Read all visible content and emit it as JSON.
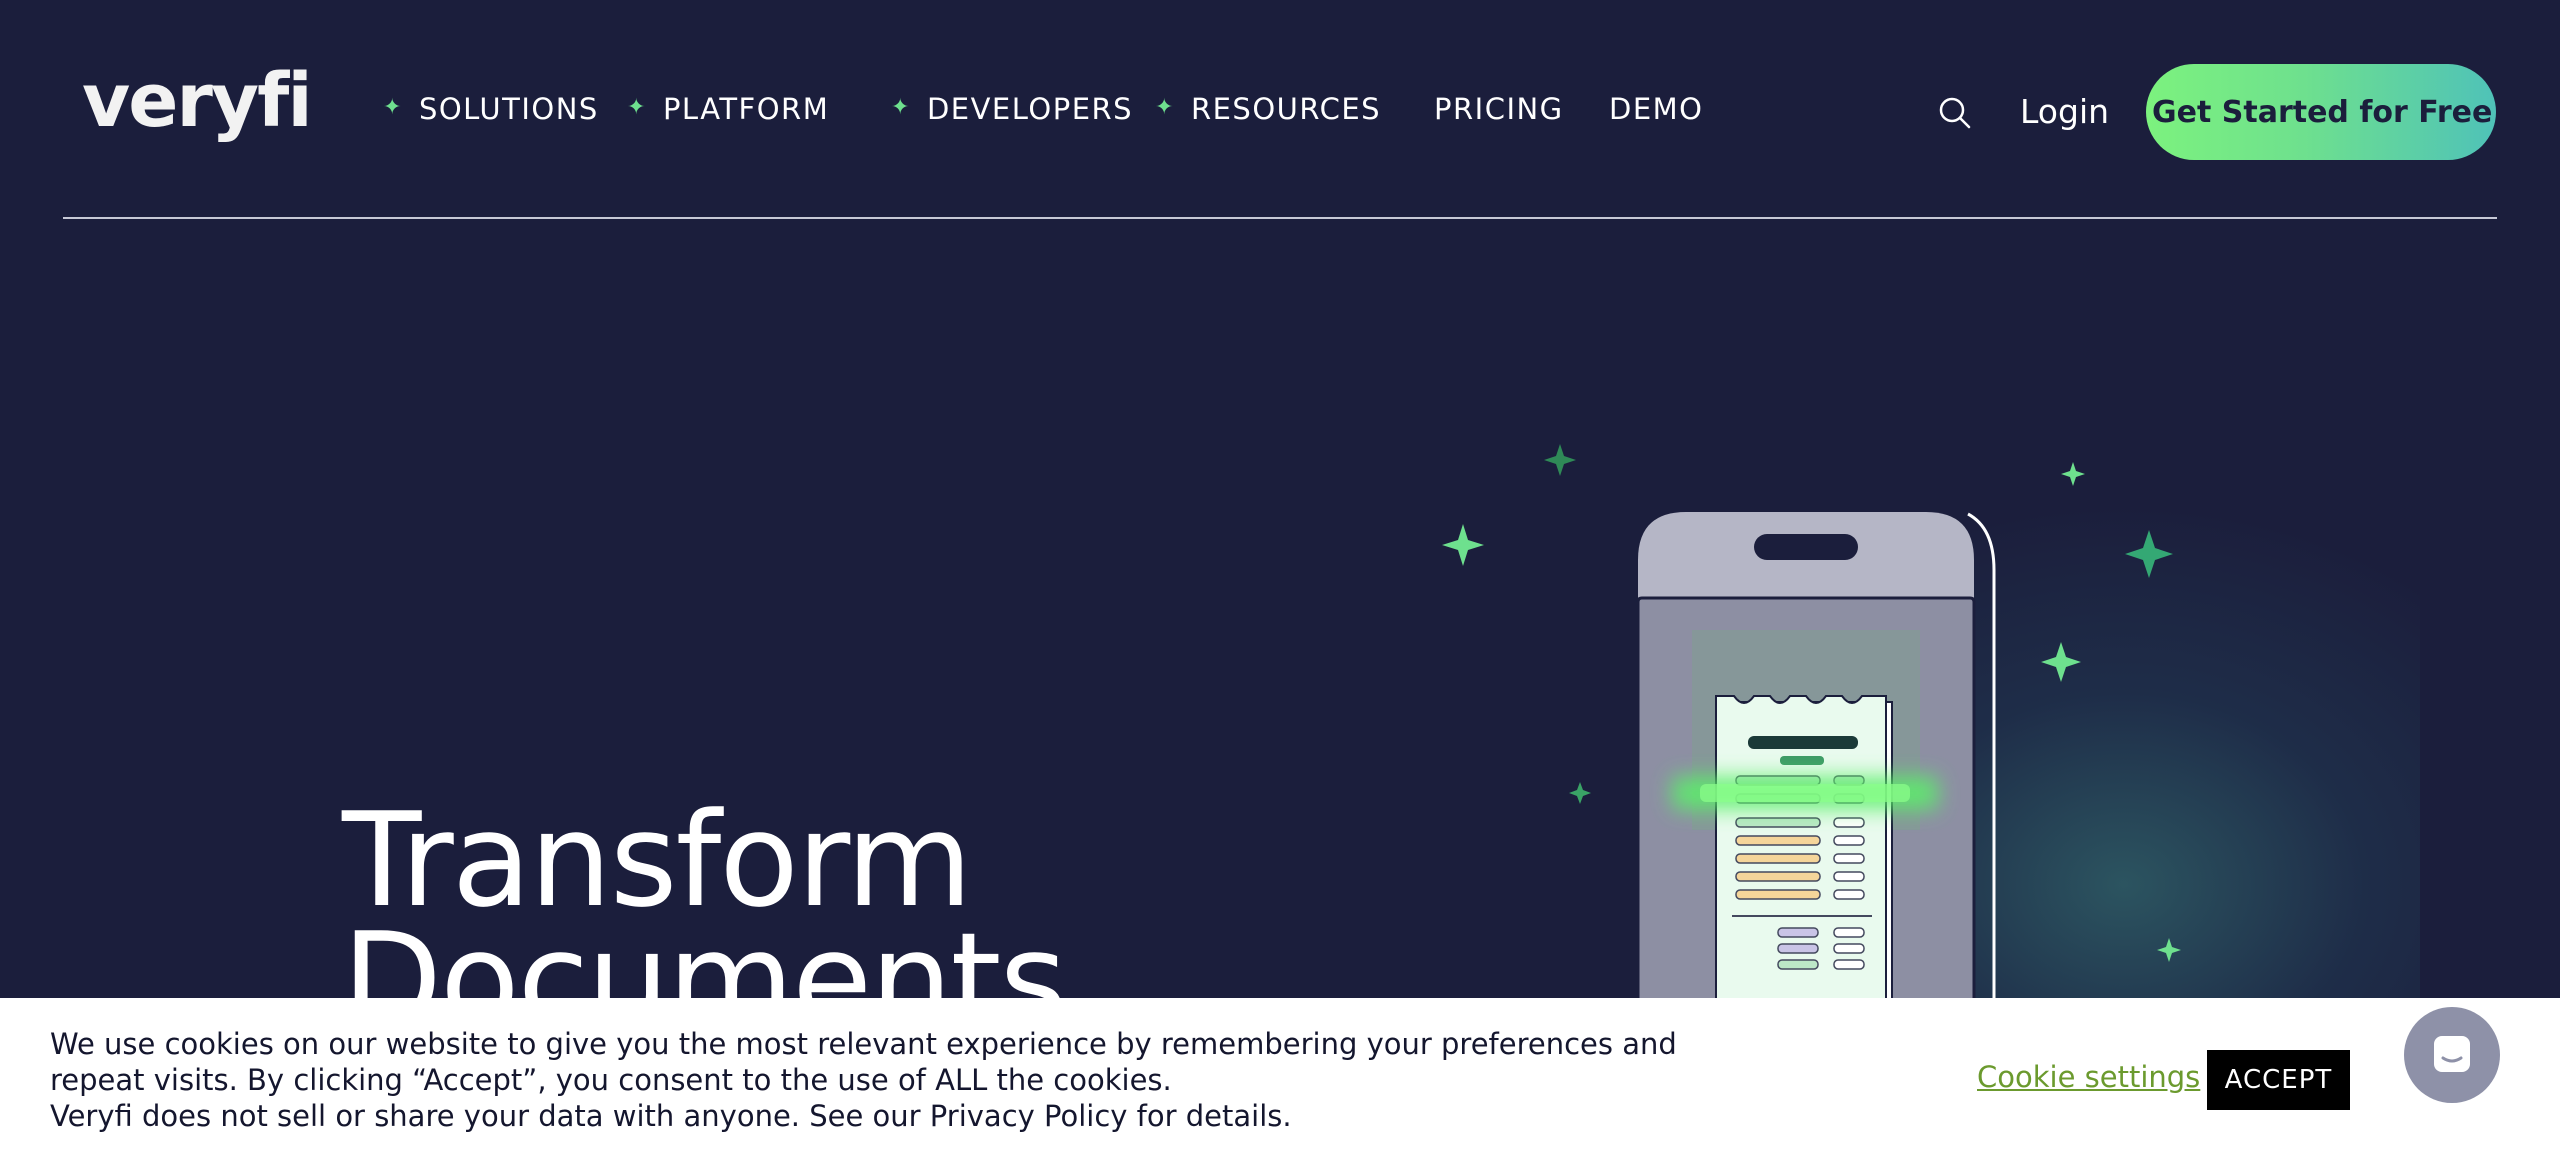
{
  "header": {
    "logo_text": "veryfi",
    "nav": [
      {
        "label": "SOLUTIONS",
        "has_spark": true
      },
      {
        "label": "PLATFORM",
        "has_spark": true
      },
      {
        "label": "DEVELOPERS",
        "has_spark": true
      },
      {
        "label": "RESOURCES",
        "has_spark": true
      },
      {
        "label": "PRICING",
        "has_spark": false
      },
      {
        "label": "DEMO",
        "has_spark": false
      }
    ],
    "spark_glyph": "✦",
    "search_icon": "search-icon",
    "login_label": "Login",
    "cta_label": "Get Started for Free"
  },
  "hero": {
    "title_line1": "Transform",
    "title_line2": "Documents"
  },
  "cookie_banner": {
    "text_line1": "We use cookies on our website to give you the most relevant experience by remembering your preferences and repeat visits. By clicking “Accept”, you consent to the use of ALL the cookies.",
    "text_line2": "Veryfi does not sell or share your data with anyone. See our Privacy Policy for details.",
    "settings_label": "Cookie settings",
    "accept_label": "ACCEPT"
  },
  "chat": {
    "icon": "chat-bubble-icon"
  },
  "colors": {
    "background": "#1b1e3c",
    "accent_green": "#6ee08e",
    "cta_gradient_start": "#7cf27e",
    "cta_gradient_end": "#4fc2b8",
    "cookie_link": "#6b9a2e"
  }
}
